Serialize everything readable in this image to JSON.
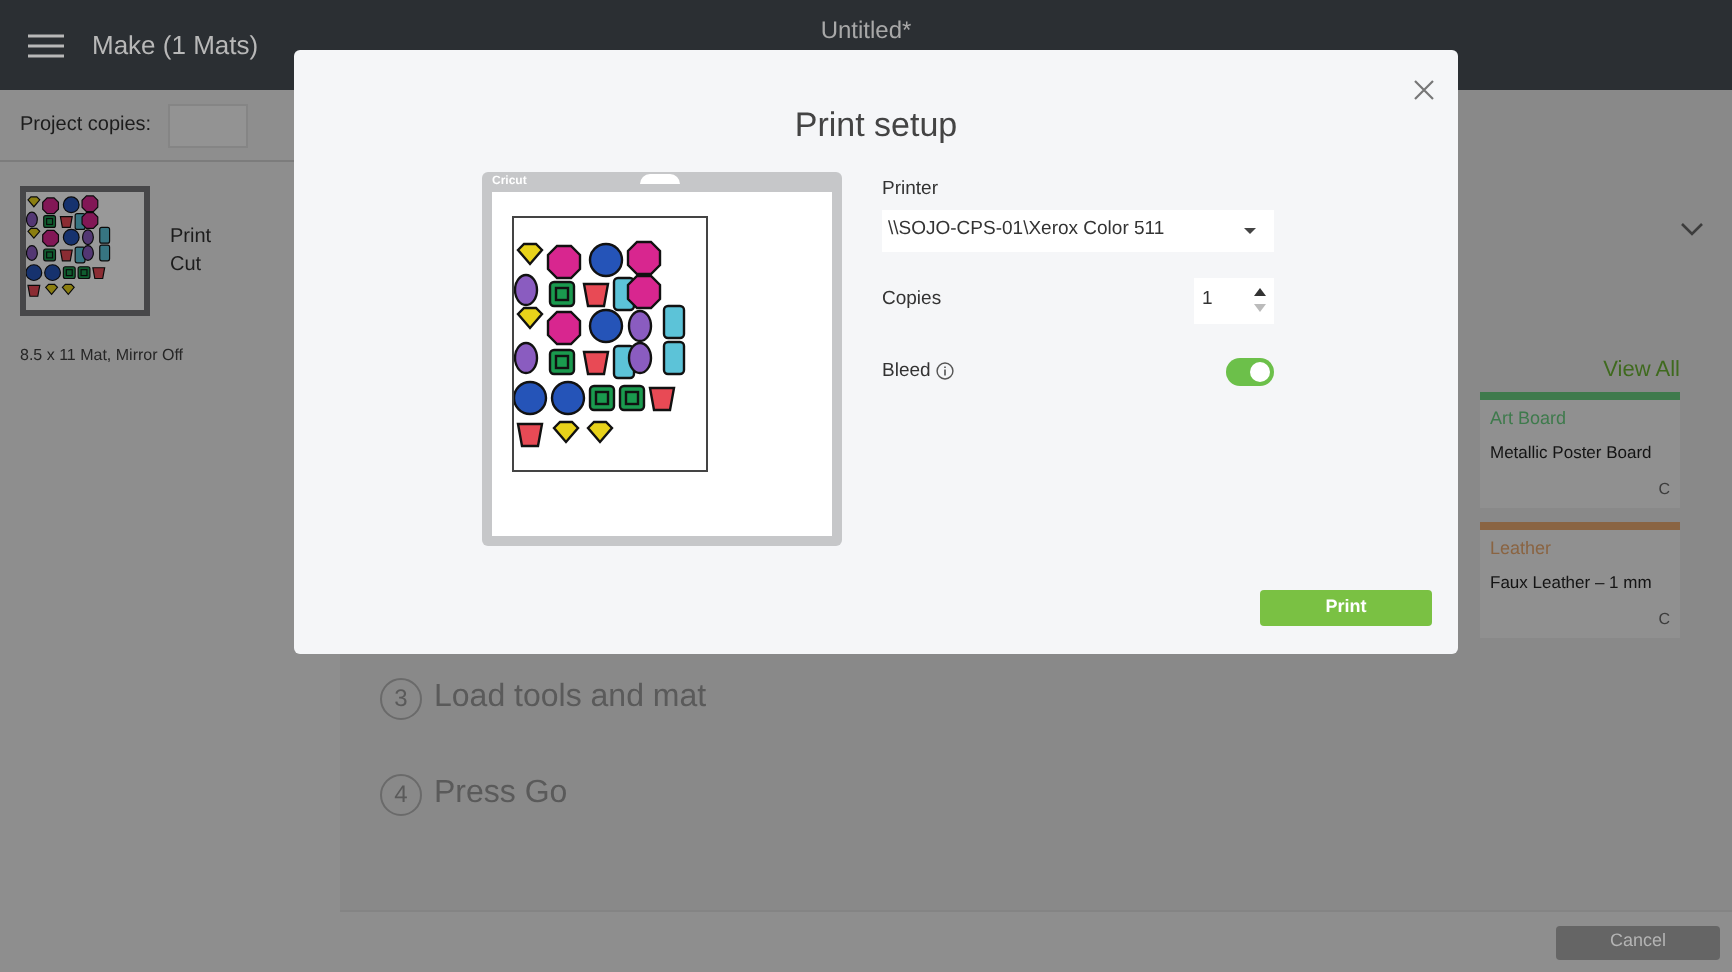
{
  "window": {
    "title": "Untitled*"
  },
  "header": {
    "menu_label": "Make (1 Mats)"
  },
  "sidebar": {
    "copies_label": "Project copies:",
    "mats": [
      {
        "labels": [
          "Print",
          "Cut"
        ],
        "caption": "8.5 x 11 Mat, Mirror Off"
      }
    ]
  },
  "steps": [
    {
      "number": "3",
      "label": "Load tools and mat"
    },
    {
      "number": "4",
      "label": "Press Go"
    }
  ],
  "materials": {
    "link": "View All",
    "cards": [
      {
        "category": "Art Board",
        "name": "Metallic Poster Board",
        "color": "#3e7a4c",
        "suffix": "C"
      },
      {
        "category": "Leather",
        "name": "Faux Leather – 1 mm",
        "color": "#8a6442",
        "suffix": "C"
      }
    ]
  },
  "footer": {
    "cancel": "Cancel"
  },
  "dialog": {
    "title": "Print setup",
    "mat_brand": "Cricut",
    "printer": {
      "label": "Printer",
      "value": "\\\\SOJO-CPS-01\\Xerox Color 511"
    },
    "copies": {
      "label": "Copies",
      "value": "1"
    },
    "bleed": {
      "label": "Bleed",
      "on": true
    },
    "print_button": "Print"
  }
}
